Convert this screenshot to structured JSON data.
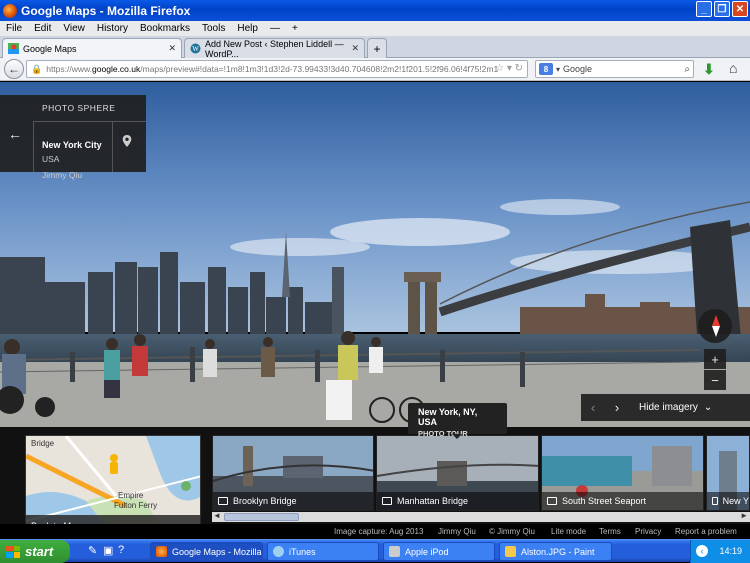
{
  "window": {
    "title": "Google Maps - Mozilla Firefox"
  },
  "menu": [
    "File",
    "Edit",
    "View",
    "History",
    "Bookmarks",
    "Tools",
    "Help"
  ],
  "tabs": [
    {
      "label": "Google Maps"
    },
    {
      "label": "Add New Post ‹ Stephen Liddell — WordP..."
    }
  ],
  "url": {
    "prefix": "https://www.",
    "domain": "google.co.uk",
    "rest": "/maps/preview#!data=!1m8!1m3!1d3!2d-73.99433!3d40.704608!2m2!1f201.5!2f96.06!4f75!2m1"
  },
  "search": {
    "engine": "Google"
  },
  "photosphere": {
    "header": "PHOTO SPHERE",
    "city": "New York City",
    "country": "USA",
    "author": "Jimmy Qiu"
  },
  "controls": {
    "hide_imagery": "Hide imagery",
    "zoom_in": "+",
    "zoom_out": "−"
  },
  "tooltip": {
    "title": "New York, NY, USA",
    "subtitle": "PHOTO TOUR"
  },
  "minimap": {
    "back_label": "Back to Map",
    "label_bridge": "Bridge",
    "label_empire": "Empire",
    "label_fulton": "Fulton Ferry"
  },
  "thumbnails": [
    {
      "caption": "Brooklyn Bridge"
    },
    {
      "caption": "Manhattan Bridge"
    },
    {
      "caption": "South Street Seaport"
    },
    {
      "caption": "New Y"
    }
  ],
  "footer": {
    "capture": "Image capture: Aug 2013",
    "author": "Jimmy Qiu",
    "copyright": "© Jimmy Qiu",
    "lite": "Lite mode",
    "terms": "Terms",
    "privacy": "Privacy",
    "report": "Report a problem"
  },
  "taskbar": {
    "start": "start",
    "items": [
      "Google Maps - Mozilla...",
      "iTunes",
      "Apple iPod",
      "Alston.JPG - Paint"
    ],
    "clock": "14:19"
  }
}
